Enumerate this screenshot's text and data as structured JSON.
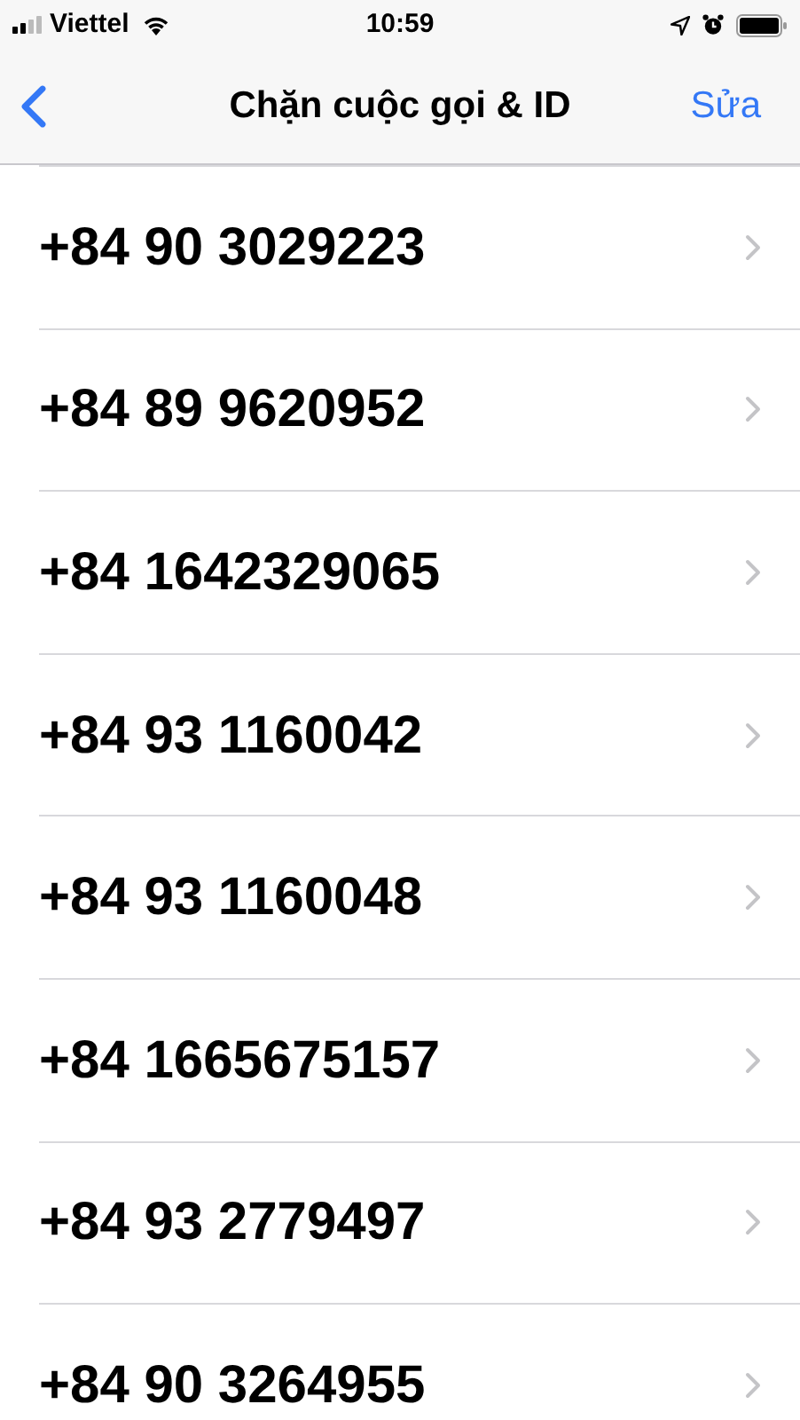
{
  "status_bar": {
    "carrier": "Viettel",
    "time": "10:59"
  },
  "nav_bar": {
    "title": "Chặn cuộc gọi & ID",
    "action": "Sửa"
  },
  "blocked_numbers": [
    {
      "number": "+84 90 3029223"
    },
    {
      "number": "+84 89 9620952"
    },
    {
      "number": "+84 1642329065"
    },
    {
      "number": "+84 93 1160042"
    },
    {
      "number": "+84 93 1160048"
    },
    {
      "number": "+84 1665675157"
    },
    {
      "number": "+84 93 2779497"
    },
    {
      "number": "+84 90 3264955"
    }
  ]
}
